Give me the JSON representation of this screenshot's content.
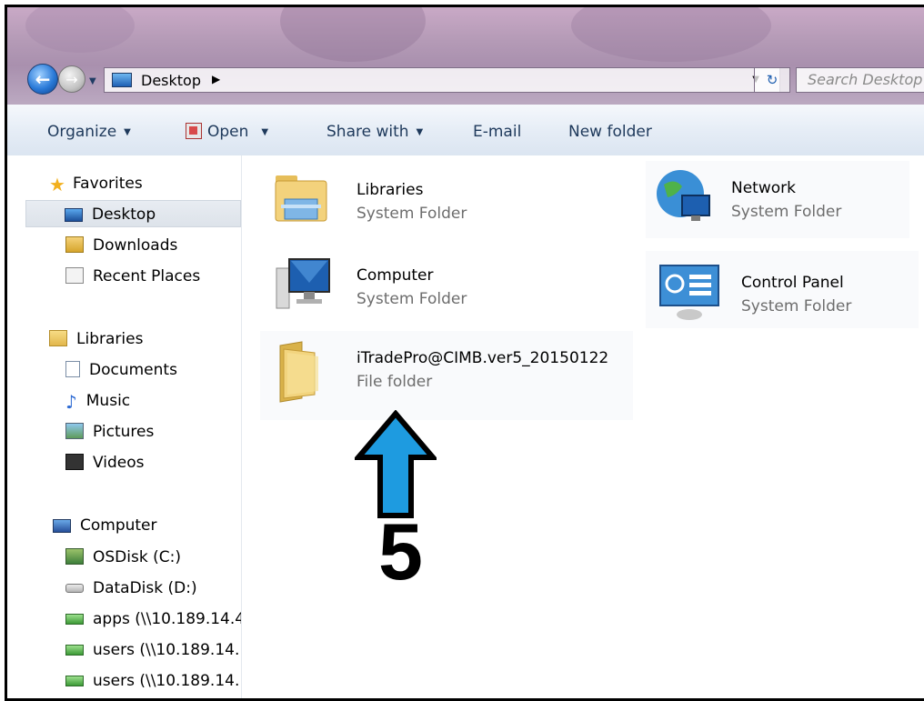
{
  "address_bar": {
    "location": "Desktop",
    "search_placeholder": "Search Desktop"
  },
  "toolbar": {
    "organize": "Organize",
    "open": "Open",
    "share_with": "Share with",
    "email": "E-mail",
    "new_folder": "New folder"
  },
  "nav": {
    "favorites": {
      "header": "Favorites",
      "items": [
        "Desktop",
        "Downloads",
        "Recent Places"
      ]
    },
    "libraries": {
      "header": "Libraries",
      "items": [
        "Documents",
        "Music",
        "Pictures",
        "Videos"
      ]
    },
    "computer": {
      "header": "Computer",
      "items": [
        "OSDisk (C:)",
        "DataDisk (D:)",
        "apps (\\\\10.189.14.4",
        "users (\\\\10.189.14.",
        "users (\\\\10.189.14."
      ]
    }
  },
  "items": [
    {
      "name": "Libraries",
      "type": "System Folder"
    },
    {
      "name": "Network",
      "type": "System Folder"
    },
    {
      "name": "Computer",
      "type": "System Folder"
    },
    {
      "name": "Control Panel",
      "type": "System Folder"
    },
    {
      "name": "iTradePro@CIMB.ver5_20150122",
      "type": "File folder"
    }
  ],
  "annotation": {
    "step_number": "5",
    "arrow_color": "#1e9be0"
  },
  "colors": {
    "selection": "#dde3ea",
    "toolbar_text": "#1e395b",
    "secondary_text": "#6d6d6d"
  }
}
